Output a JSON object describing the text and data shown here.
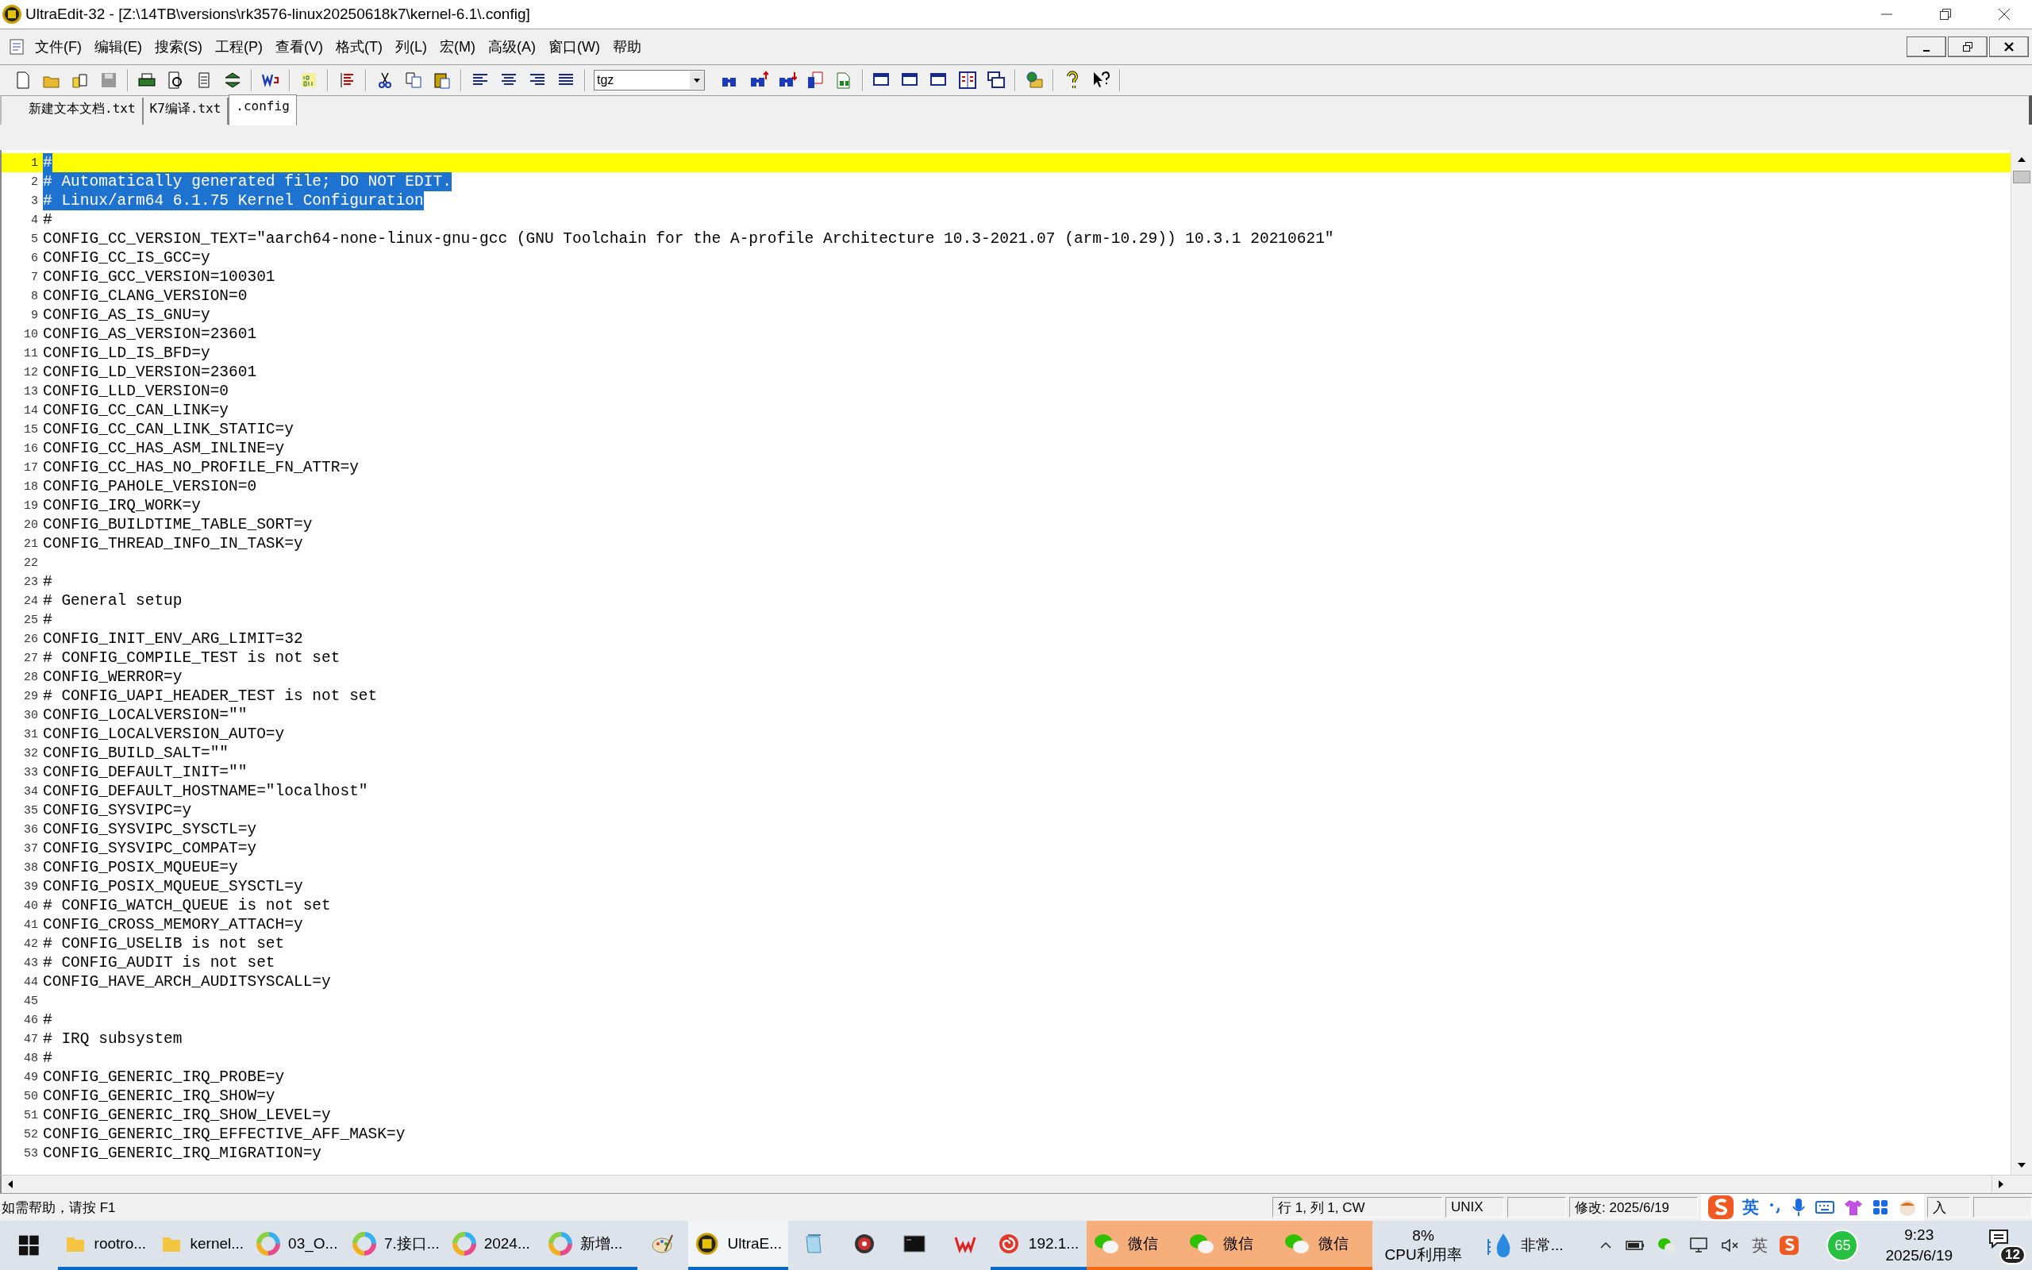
{
  "window": {
    "title": "UltraEdit-32 - [Z:\\14TB\\versions\\rk3576-linux20250618k7\\kernel-6.1\\.config]"
  },
  "menu": [
    "文件(F)",
    "编辑(E)",
    "搜索(S)",
    "工程(P)",
    "查看(V)",
    "格式(T)",
    "列(L)",
    "宏(M)",
    "高级(A)",
    "窗口(W)",
    "帮助"
  ],
  "toolbar": {
    "combo_value": "tgz"
  },
  "tabs": [
    {
      "label": "新建文本文档.txt",
      "selected": false
    },
    {
      "label": "K7编译.txt",
      "selected": false
    },
    {
      "label": ".config",
      "selected": true
    }
  ],
  "editor": {
    "lines": [
      {
        "n": "1",
        "text": "#",
        "selected": true,
        "current": true
      },
      {
        "n": "2",
        "text": "# Automatically generated file; DO NOT EDIT.",
        "selected": true,
        "current": false
      },
      {
        "n": "3",
        "text": "# Linux/arm64 6.1.75 Kernel Configuration",
        "selected": true,
        "current": false
      },
      {
        "n": "4",
        "text": "#",
        "selected": false,
        "current": false
      },
      {
        "n": "5",
        "text": "CONFIG_CC_VERSION_TEXT=\"aarch64-none-linux-gnu-gcc (GNU Toolchain for the A-profile Architecture 10.3-2021.07 (arm-10.29)) 10.3.1 20210621\"",
        "selected": false,
        "current": false
      },
      {
        "n": "6",
        "text": "CONFIG_CC_IS_GCC=y",
        "selected": false,
        "current": false
      },
      {
        "n": "7",
        "text": "CONFIG_GCC_VERSION=100301",
        "selected": false,
        "current": false
      },
      {
        "n": "8",
        "text": "CONFIG_CLANG_VERSION=0",
        "selected": false,
        "current": false
      },
      {
        "n": "9",
        "text": "CONFIG_AS_IS_GNU=y",
        "selected": false,
        "current": false
      },
      {
        "n": "10",
        "text": "CONFIG_AS_VERSION=23601",
        "selected": false,
        "current": false
      },
      {
        "n": "11",
        "text": "CONFIG_LD_IS_BFD=y",
        "selected": false,
        "current": false
      },
      {
        "n": "12",
        "text": "CONFIG_LD_VERSION=23601",
        "selected": false,
        "current": false
      },
      {
        "n": "13",
        "text": "CONFIG_LLD_VERSION=0",
        "selected": false,
        "current": false
      },
      {
        "n": "14",
        "text": "CONFIG_CC_CAN_LINK=y",
        "selected": false,
        "current": false
      },
      {
        "n": "15",
        "text": "CONFIG_CC_CAN_LINK_STATIC=y",
        "selected": false,
        "current": false
      },
      {
        "n": "16",
        "text": "CONFIG_CC_HAS_ASM_INLINE=y",
        "selected": false,
        "current": false
      },
      {
        "n": "17",
        "text": "CONFIG_CC_HAS_NO_PROFILE_FN_ATTR=y",
        "selected": false,
        "current": false
      },
      {
        "n": "18",
        "text": "CONFIG_PAHOLE_VERSION=0",
        "selected": false,
        "current": false
      },
      {
        "n": "19",
        "text": "CONFIG_IRQ_WORK=y",
        "selected": false,
        "current": false
      },
      {
        "n": "20",
        "text": "CONFIG_BUILDTIME_TABLE_SORT=y",
        "selected": false,
        "current": false
      },
      {
        "n": "21",
        "text": "CONFIG_THREAD_INFO_IN_TASK=y",
        "selected": false,
        "current": false
      },
      {
        "n": "22",
        "selected": false,
        "current": false
      },
      {
        "n": "23",
        "text": "#",
        "selected": false,
        "current": false
      },
      {
        "n": "24",
        "text": "# General setup",
        "selected": false,
        "current": false
      },
      {
        "n": "25",
        "text": "#",
        "selected": false,
        "current": false
      },
      {
        "n": "26",
        "text": "CONFIG_INIT_ENV_ARG_LIMIT=32",
        "selected": false,
        "current": false
      },
      {
        "n": "27",
        "text": "# CONFIG_COMPILE_TEST is not set",
        "selected": false,
        "current": false
      },
      {
        "n": "28",
        "text": "CONFIG_WERROR=y",
        "selected": false,
        "current": false
      },
      {
        "n": "29",
        "text": "# CONFIG_UAPI_HEADER_TEST is not set",
        "selected": false,
        "current": false
      },
      {
        "n": "30",
        "text": "CONFIG_LOCALVERSION=\"\"",
        "selected": false,
        "current": false
      },
      {
        "n": "31",
        "text": "CONFIG_LOCALVERSION_AUTO=y",
        "selected": false,
        "current": false
      },
      {
        "n": "32",
        "text": "CONFIG_BUILD_SALT=\"\"",
        "selected": false,
        "current": false
      },
      {
        "n": "33",
        "text": "CONFIG_DEFAULT_INIT=\"\"",
        "selected": false,
        "current": false
      },
      {
        "n": "34",
        "text": "CONFIG_DEFAULT_HOSTNAME=\"localhost\"",
        "selected": false,
        "current": false
      },
      {
        "n": "35",
        "text": "CONFIG_SYSVIPC=y",
        "selected": false,
        "current": false
      },
      {
        "n": "36",
        "text": "CONFIG_SYSVIPC_SYSCTL=y",
        "selected": false,
        "current": false
      },
      {
        "n": "37",
        "text": "CONFIG_SYSVIPC_COMPAT=y",
        "selected": false,
        "current": false
      },
      {
        "n": "38",
        "text": "CONFIG_POSIX_MQUEUE=y",
        "selected": false,
        "current": false
      },
      {
        "n": "39",
        "text": "CONFIG_POSIX_MQUEUE_SYSCTL=y",
        "selected": false,
        "current": false
      },
      {
        "n": "40",
        "text": "# CONFIG_WATCH_QUEUE is not set",
        "selected": false,
        "current": false
      },
      {
        "n": "41",
        "text": "CONFIG_CROSS_MEMORY_ATTACH=y",
        "selected": false,
        "current": false
      },
      {
        "n": "42",
        "text": "# CONFIG_USELIB is not set",
        "selected": false,
        "current": false
      },
      {
        "n": "43",
        "text": "# CONFIG_AUDIT is not set",
        "selected": false,
        "current": false
      },
      {
        "n": "44",
        "text": "CONFIG_HAVE_ARCH_AUDITSYSCALL=y",
        "selected": false,
        "current": false
      },
      {
        "n": "45",
        "selected": false,
        "current": false
      },
      {
        "n": "46",
        "text": "#",
        "selected": false,
        "current": false
      },
      {
        "n": "47",
        "text": "# IRQ subsystem",
        "selected": false,
        "current": false
      },
      {
        "n": "48",
        "text": "#",
        "selected": false,
        "current": false
      },
      {
        "n": "49",
        "text": "CONFIG_GENERIC_IRQ_PROBE=y",
        "selected": false,
        "current": false
      },
      {
        "n": "50",
        "text": "CONFIG_GENERIC_IRQ_SHOW=y",
        "selected": false,
        "current": false
      },
      {
        "n": "51",
        "text": "CONFIG_GENERIC_IRQ_SHOW_LEVEL=y",
        "selected": false,
        "current": false
      },
      {
        "n": "52",
        "text": "CONFIG_GENERIC_IRQ_EFFECTIVE_AFF_MASK=y",
        "selected": false,
        "current": false
      },
      {
        "n": "53",
        "text": "CONFIG_GENERIC_IRQ_MIGRATION=y",
        "selected": false,
        "current": false
      }
    ]
  },
  "status_bar": {
    "help": "如需帮助，请按 F1",
    "position": "行 1, 列 1, CW",
    "line_ending": "UNIX",
    "modified": "修改: 2025/6/19",
    "input_mode": "入"
  },
  "ime_bar": {
    "language": "英"
  },
  "taskbar": {
    "items": [
      {
        "kind": "folder",
        "label": "rootro...",
        "active": false,
        "running": true,
        "attention": false
      },
      {
        "kind": "folder",
        "label": "kernel...",
        "active": false,
        "running": true,
        "attention": false
      },
      {
        "kind": "browser",
        "label": "03_O...",
        "active": false,
        "running": true,
        "attention": false
      },
      {
        "kind": "browser",
        "label": "7.接口...",
        "active": false,
        "running": true,
        "attention": false
      },
      {
        "kind": "browser",
        "label": "2024...",
        "active": false,
        "running": true,
        "attention": false
      },
      {
        "kind": "browser",
        "label": "新增...",
        "active": false,
        "running": true,
        "attention": false
      },
      {
        "kind": "paint",
        "active": false,
        "running": false,
        "attention": false
      },
      {
        "kind": "editor",
        "label": "UltraE...",
        "active": true,
        "running": true,
        "attention": false
      },
      {
        "kind": "notepad",
        "active": false,
        "running": false,
        "attention": false
      },
      {
        "kind": "disc",
        "active": false,
        "running": false,
        "attention": false
      },
      {
        "kind": "terminal",
        "active": false,
        "running": false,
        "attention": false
      },
      {
        "kind": "office",
        "active": false,
        "running": false,
        "attention": false
      },
      {
        "kind": "swirl",
        "label": "192.1...",
        "active": false,
        "running": true,
        "attention": false
      },
      {
        "kind": "chat",
        "label": "微信",
        "active": false,
        "running": true,
        "attention": true
      },
      {
        "kind": "chat",
        "label": "微信",
        "active": false,
        "running": true,
        "attention": true
      },
      {
        "kind": "chat",
        "label": "微信",
        "active": false,
        "running": true,
        "attention": true
      }
    ],
    "cpu": {
      "value": "8%",
      "label": "CPU利用率"
    },
    "weather": {
      "label": "非常..."
    },
    "tray_language": "英",
    "tray_badge": "65",
    "clock": {
      "time": "9:23",
      "date": "2025/6/19"
    },
    "notifications": "12"
  }
}
